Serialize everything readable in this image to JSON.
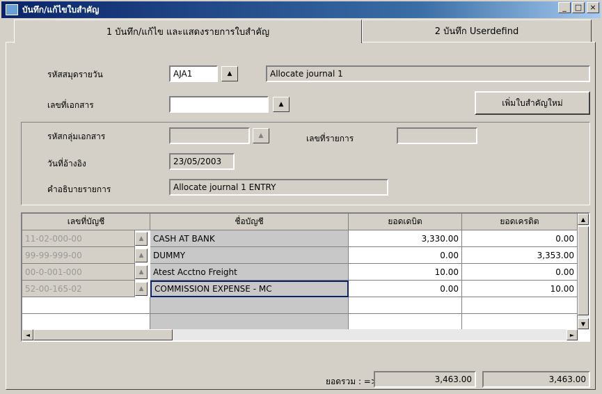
{
  "window": {
    "title": "บันทึก/แก้ไขใบสำคัญ",
    "minimize": "_",
    "maximize": "□",
    "close": "×"
  },
  "tabs": [
    {
      "label": "1 บันทึก/แก้ไข และแสดงรายการใบสำคัญ"
    },
    {
      "label": "2 บันทึก Userdefind"
    }
  ],
  "form": {
    "journal_code_label": "รหัสสมุดรายวัน",
    "journal_code_value": "AJA1",
    "journal_desc_value": "Allocate journal 1",
    "doc_no_label": "เลขที่เอกสาร",
    "doc_no_value": "",
    "new_voucher_button": "เพิ่มใบสำคัญใหม่",
    "doc_group_label": "รหัสกลุ่มเอกสาร",
    "doc_group_value": "",
    "item_no_label": "เลขที่รายการ",
    "item_no_value": "",
    "ref_date_label": "วันที่อ้างอิง",
    "ref_date_value": "23/05/2003",
    "desc_label": "คำอธิบายรายการ",
    "desc_value": "Allocate journal 1 ENTRY"
  },
  "grid": {
    "headers": [
      "เลขที่บัญชี",
      "ชื่อบัญชี",
      "ยอดเดบิต",
      "ยอดเครดิต"
    ],
    "rows": [
      {
        "account": "11-02-000-00",
        "name": "CASH AT BANK",
        "debit": "3,330.00",
        "credit": "0.00"
      },
      {
        "account": "99-99-999-00",
        "name": "DUMMY",
        "debit": "0.00",
        "credit": "3,353.00"
      },
      {
        "account": "00-0-001-000",
        "name": "Atest Acctno Freight",
        "debit": "10.00",
        "credit": "0.00"
      },
      {
        "account": "52-00-165-02",
        "name": "COMMISSION EXPENSE - MC",
        "debit": "0.00",
        "credit": "10.00"
      }
    ]
  },
  "totals": {
    "label": "ยอดรวม : =>",
    "debit": "3,463.00",
    "credit": "3,463.00"
  },
  "icons": {
    "dropdown": "dropdown-arrow-icon",
    "scroll_up": "▲",
    "scroll_down": "▼",
    "scroll_left": "◄",
    "scroll_right": "►"
  },
  "colors": {
    "titlebar": "#0a246a",
    "face": "#d4d0c8",
    "selection_border": "#0a246a"
  }
}
